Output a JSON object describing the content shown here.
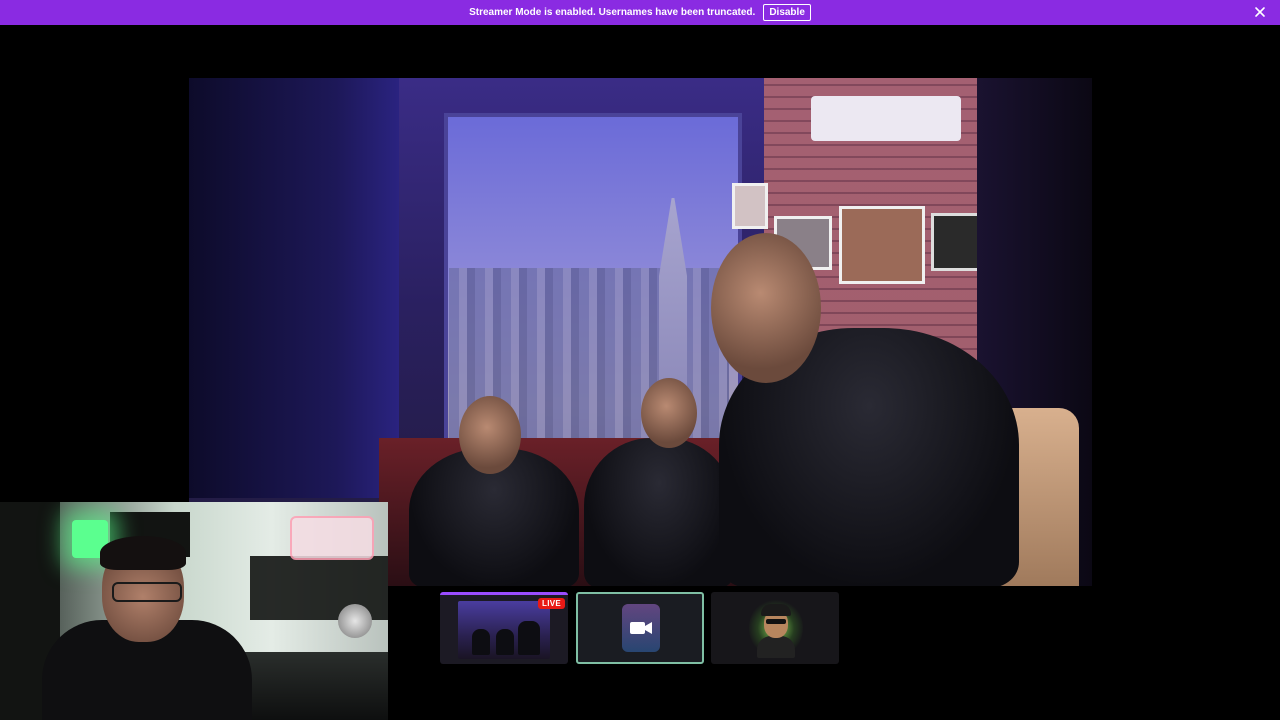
{
  "banner": {
    "message": "Streamer Mode is enabled. Usernames have been truncated.",
    "disable_label": "Disable",
    "close_icon": "close-icon",
    "background_color": "#8a2be2"
  },
  "stream_tiles": {
    "active_index": 0,
    "live_badge": "LIVE",
    "live_badge_color": "#e91916",
    "tile_icons": [
      "stream-preview",
      "video-camera-icon",
      "avatar"
    ]
  }
}
